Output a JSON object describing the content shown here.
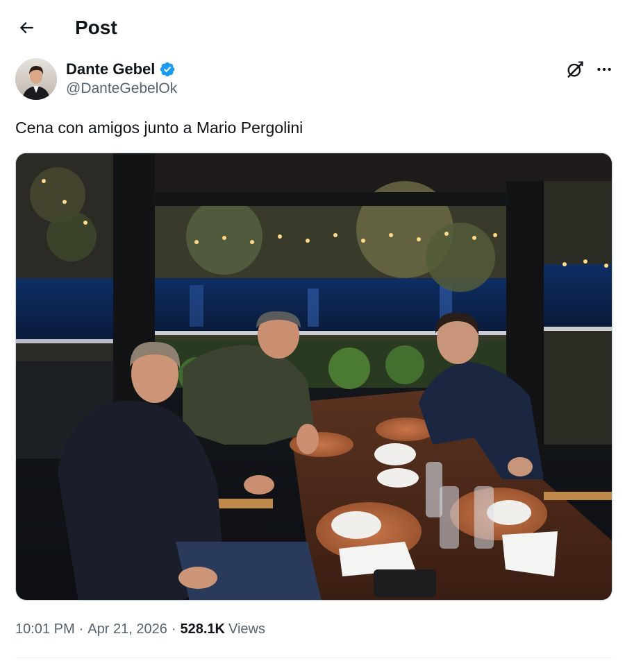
{
  "header": {
    "title": "Post",
    "back_icon": "arrow-left-icon"
  },
  "author": {
    "display_name": "Dante Gebel",
    "handle": "@DanteGebelOk",
    "verified": true,
    "verified_color": "#1d9bf0"
  },
  "actions": {
    "grok_icon": "grok-icon",
    "more_icon": "more-horizontal-icon"
  },
  "tweet": {
    "text": "Cena con amigos junto a Mario Pergolini"
  },
  "media": {
    "type": "photo",
    "icon": "photo-icon"
  },
  "meta": {
    "time": "10:01 PM",
    "separator": "·",
    "date": "Apr 21, 2026",
    "views_count": "528.1K",
    "views_label": "Views"
  },
  "colors": {
    "text_primary": "#0f1419",
    "text_secondary": "#536471",
    "accent": "#1d9bf0",
    "divider": "#eff3f4"
  }
}
